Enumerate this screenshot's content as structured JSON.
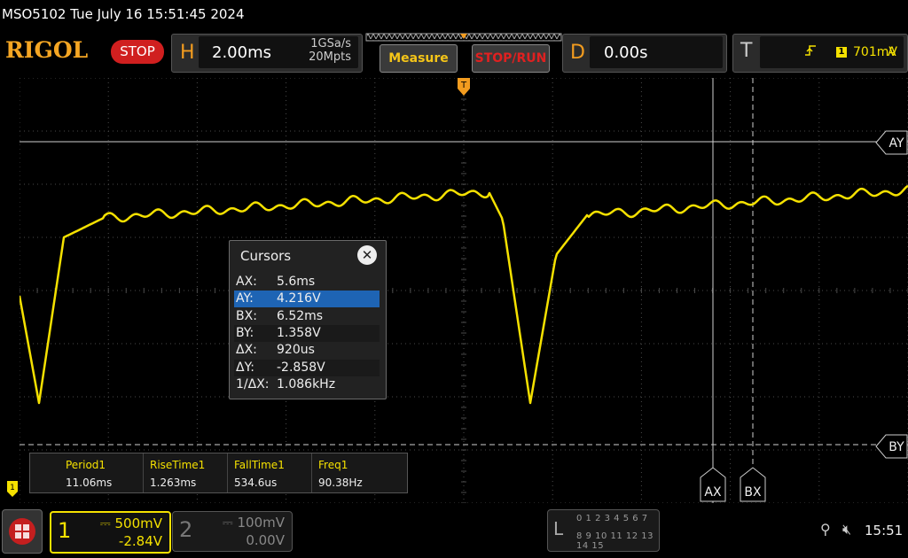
{
  "title": "MSO5102  Tue July 16 15:51:45 2024",
  "brand": "RIGOL",
  "run_state": "STOP",
  "horizontal": {
    "letter": "H",
    "timebase": "2.00ms",
    "sample_rate": "1GSa/s",
    "memory_depth": "20Mpts"
  },
  "buttons": {
    "measure": "Measure",
    "stop_run": "STOP/RUN"
  },
  "delay": {
    "letter": "D",
    "value": "0.00s"
  },
  "trigger": {
    "letter": "T",
    "source_num": "1",
    "level": "701mV",
    "mode": "A"
  },
  "cursors_panel": {
    "title": "Cursors",
    "rows": [
      {
        "key": "AX:",
        "value": "5.6ms"
      },
      {
        "key": "AY:",
        "value": "4.216V"
      },
      {
        "key": "BX:",
        "value": "6.52ms"
      },
      {
        "key": "BY:",
        "value": "1.358V"
      },
      {
        "key": "ΔX:",
        "value": "920us"
      },
      {
        "key": "ΔY:",
        "value": "-2.858V"
      },
      {
        "key": "1/ΔX:",
        "value": "1.086kHz"
      }
    ],
    "selected_row": 1
  },
  "cursor_labels": {
    "ax": "AX",
    "bx": "BX",
    "ay": "AY",
    "by": "BY"
  },
  "measurements": [
    {
      "name": "Period1",
      "value": "11.06ms"
    },
    {
      "name": "RiseTime1",
      "value": "1.263ms"
    },
    {
      "name": "FallTime1",
      "value": "534.6us"
    },
    {
      "name": "Freq1",
      "value": "90.38Hz"
    }
  ],
  "channels": [
    {
      "num": "1",
      "scale": "500mV",
      "offset": "-2.84V",
      "active": true
    },
    {
      "num": "2",
      "scale": "100mV",
      "offset": "0.00V",
      "active": false
    }
  ],
  "logic": {
    "letter": "L",
    "row1": "0 1 2 3  4 5 6 7",
    "row2": "8 9 10 11 12 13 14 15"
  },
  "ground_marker": "1",
  "clock": "15:51",
  "colors": {
    "ch1": "#f5e100",
    "accent": "#f39c1f",
    "stop": "#d01f1f",
    "grid": "#555555"
  }
}
